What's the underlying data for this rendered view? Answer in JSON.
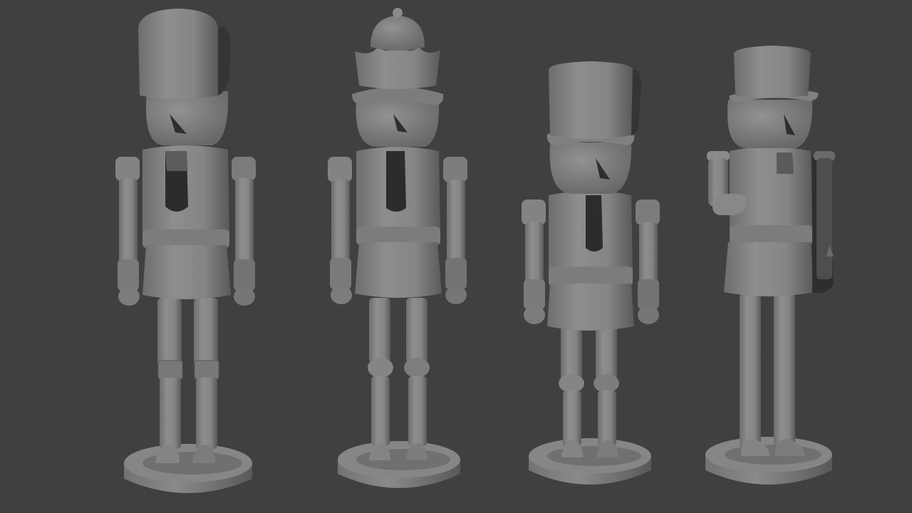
{
  "scene": {
    "background": "#404040",
    "material_light": "#8a8a8a",
    "material_mid": "#727272",
    "material_dark": "#4c4c4c",
    "shadow": "#262626",
    "figures": [
      {
        "id": "nutcracker-1",
        "hat": "tall-busby"
      },
      {
        "id": "nutcracker-2",
        "hat": "crown-with-knob"
      },
      {
        "id": "nutcracker-3",
        "hat": "top-hat"
      },
      {
        "id": "nutcracker-4",
        "hat": "top-hat-profile"
      }
    ]
  }
}
